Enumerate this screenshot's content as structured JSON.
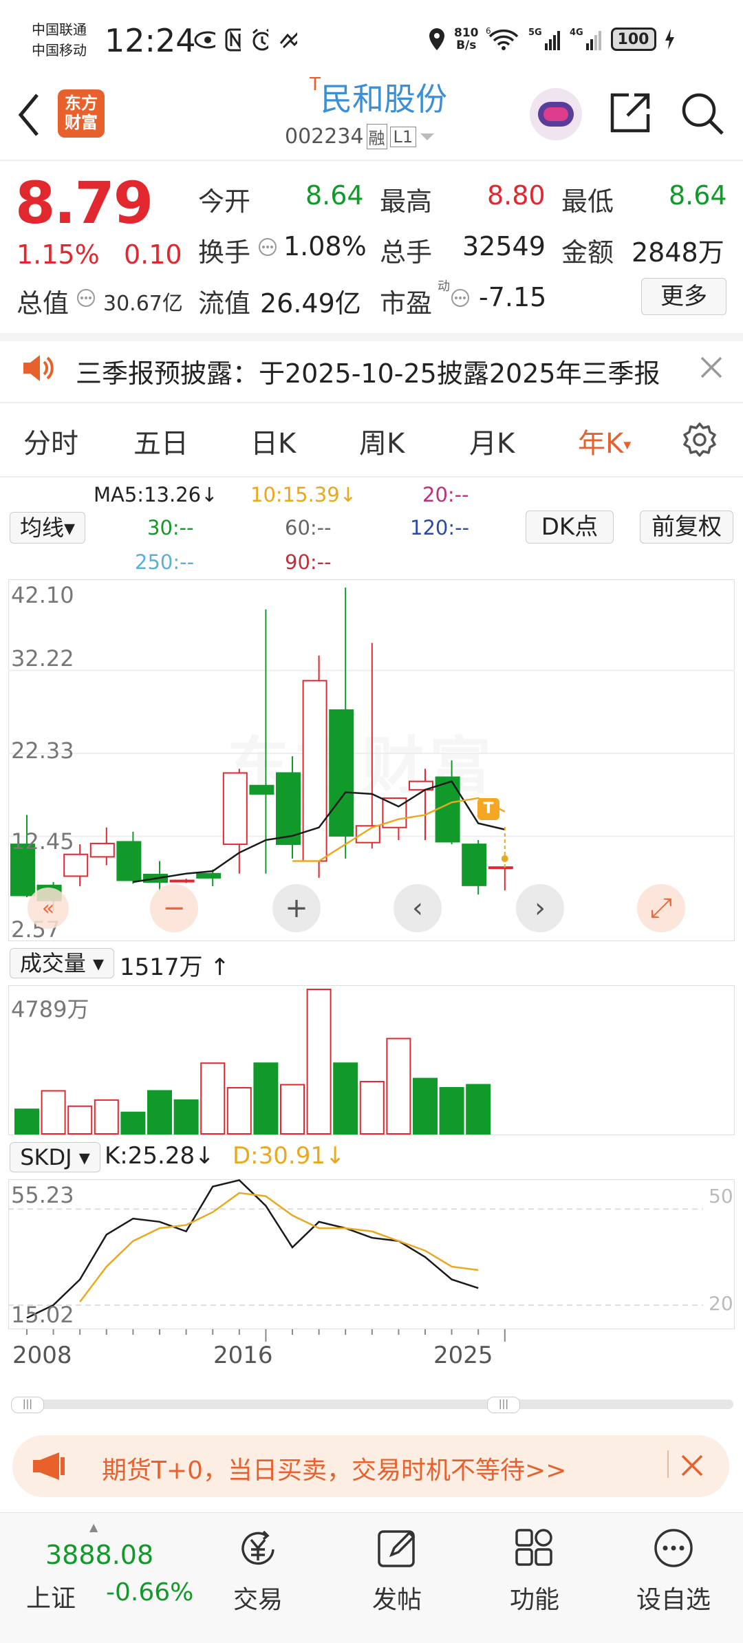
{
  "status_bar": {
    "carrier1": "中国联通",
    "carrier2": "中国移动",
    "time": "12:24",
    "net_speed_value": "810",
    "net_speed_unit": "B/s",
    "battery": "100"
  },
  "header": {
    "logo_line1": "东方",
    "logo_line2": "财富",
    "title_prefix": "T",
    "title": "民和股份",
    "code": "002234",
    "badge1": "融",
    "badge2": "L1"
  },
  "quote": {
    "price": "8.79",
    "change_pct": "1.15%",
    "change_amt": "0.10",
    "open_label": "今开",
    "open": "8.64",
    "high_label": "最高",
    "high": "8.80",
    "low_label": "最低",
    "low": "8.64",
    "turnover_label": "换手",
    "turnover": "1.08%",
    "volume_label": "总手",
    "volume": "32549",
    "amount_label": "金额",
    "amount": "2848万",
    "mcap_label": "总值",
    "mcap": "30.67亿",
    "float_label": "流值",
    "float": "26.49亿",
    "pe_label": "市盈",
    "pe_sup": "动",
    "pe": "-7.15",
    "more_label": "更多"
  },
  "notice": {
    "text": "三季报预披露：于2025-10-25披露2025年三季报"
  },
  "tabs": [
    "分时",
    "五日",
    "日K",
    "周K",
    "月K",
    "年K"
  ],
  "active_tab": "年K",
  "ma_legend": {
    "ma5": "MA5:13.26↓",
    "ma10": "10:15.39↓",
    "ma20": "20:--",
    "ma30": "30:--",
    "ma60": "60:--",
    "ma120": "120:--",
    "ma250": "250:--",
    "ma90": "90:--",
    "select_label": "均线▾",
    "dk_label": "DK点",
    "fq_label": "前复权"
  },
  "price_axis": [
    "42.10",
    "32.22",
    "22.33",
    "12.45",
    "2.57"
  ],
  "volume": {
    "select_label": "成交量 ▾",
    "value": "1517万",
    "arrow": "↑",
    "axis_top": "4789万"
  },
  "skdj": {
    "select_label": "SKDJ ▾",
    "k": "K:25.28↓",
    "d": "D:30.91↓",
    "axis_top": "55.23",
    "axis_bottom": "15.02",
    "ref_high": "50",
    "ref_low": "20"
  },
  "x_axis": [
    "2008",
    "2016",
    "2025"
  ],
  "ad_banner": {
    "text": "期货T+0，当日买卖，交易时机不等待>>"
  },
  "bottom_nav": {
    "index_value": "3888.08",
    "index_name": "上证",
    "index_change": "-0.66%",
    "trade": "交易",
    "post": "发帖",
    "functions": "功能",
    "watchlist": "设自选"
  },
  "colors": {
    "up": "#e0282e",
    "down": "#119a2a",
    "accent": "#e8602c",
    "ma5": "#1a1a1a",
    "ma10": "#e8a820"
  },
  "chart_data": [
    {
      "type": "candlestick",
      "x": [
        "2007",
        "2008",
        "2009",
        "2010",
        "2011",
        "2012",
        "2013",
        "2014",
        "2015",
        "2016",
        "2017",
        "2018",
        "2019",
        "2020",
        "2021",
        "2022",
        "2023",
        "2024",
        "2025"
      ],
      "open": [
        11.5,
        6.6,
        7.7,
        10.0,
        11.8,
        7.9,
        7.2,
        8.0,
        11.5,
        18.5,
        20.0,
        9.5,
        27.5,
        11.7,
        13.5,
        18.0,
        19.5,
        11.5,
        8.69
      ],
      "close": [
        5.4,
        4.8,
        10.3,
        11.6,
        7.2,
        7.0,
        7.2,
        7.5,
        20.0,
        17.5,
        11.5,
        31.0,
        12.5,
        13.7,
        17.0,
        19.0,
        11.8,
        6.6,
        8.79
      ],
      "high": [
        15.0,
        7.0,
        11.5,
        13.5,
        13.0,
        9.5,
        7.4,
        8.5,
        20.5,
        39.5,
        22.0,
        34.0,
        42.1,
        35.5,
        15.5,
        20.5,
        21.5,
        12.0,
        8.8
      ],
      "low": [
        5.2,
        3.5,
        6.5,
        9.0,
        6.8,
        6.0,
        6.9,
        6.5,
        8.0,
        8.0,
        9.8,
        7.5,
        9.8,
        11.0,
        12.0,
        12.0,
        11.5,
        5.5,
        6.0
      ],
      "ma5": [
        null,
        null,
        null,
        null,
        7.0,
        7.5,
        8.0,
        8.3,
        10.5,
        12.0,
        12.5,
        13.5,
        17.7,
        17.5,
        16.0,
        18.0,
        19.0,
        14.0,
        13.26
      ],
      "ma10": [
        null,
        null,
        null,
        null,
        null,
        null,
        null,
        null,
        null,
        null,
        9.5,
        9.5,
        11.5,
        13.5,
        14.5,
        15.0,
        16.5,
        17.0,
        15.39
      ],
      "ylim": [
        2.57,
        42.1
      ]
    },
    {
      "type": "bar",
      "name": "成交量",
      "x": [
        "2007",
        "2008",
        "2009",
        "2010",
        "2011",
        "2012",
        "2013",
        "2014",
        "2015",
        "2016",
        "2017",
        "2018",
        "2019",
        "2020",
        "2021",
        "2022",
        "2023",
        "2024",
        "2025"
      ],
      "values": [
        8,
        14,
        9,
        11,
        7,
        14,
        11,
        23,
        15,
        23,
        16,
        47,
        23,
        17,
        31,
        18,
        15,
        16,
        null
      ],
      "up": [
        false,
        true,
        true,
        true,
        false,
        false,
        false,
        true,
        true,
        false,
        true,
        true,
        false,
        true,
        true,
        false,
        false,
        false,
        null
      ],
      "unit": "百万",
      "ylim": [
        0,
        47.89
      ]
    },
    {
      "type": "line",
      "name": "SKDJ",
      "x": [
        "2007",
        "2008",
        "2009",
        "2010",
        "2011",
        "2012",
        "2013",
        "2014",
        "2015",
        "2016",
        "2017",
        "2018",
        "2019",
        "2020",
        "2021",
        "2022",
        "2023",
        "2024",
        "2025"
      ],
      "series": [
        {
          "name": "K",
          "values": [
            16,
            20,
            28,
            42,
            47,
            46,
            43,
            57,
            59,
            51,
            38,
            46,
            44,
            41,
            40,
            35,
            28,
            25.28,
            null
          ]
        },
        {
          "name": "D",
          "values": [
            null,
            null,
            21,
            32,
            40,
            44,
            45,
            49,
            55,
            54,
            48,
            44,
            44,
            43,
            40,
            37,
            32,
            30.91,
            null
          ]
        }
      ],
      "ylim": [
        15.02,
        61.0
      ]
    }
  ]
}
